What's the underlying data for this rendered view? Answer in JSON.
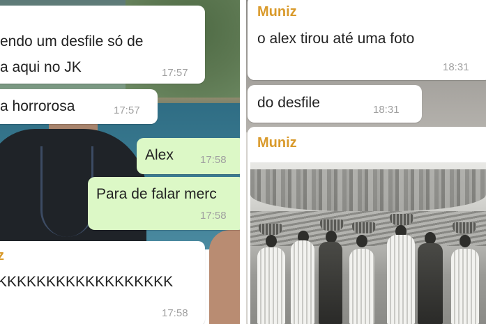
{
  "left": {
    "messages": [
      {
        "line1": "endo um desfile só de",
        "line2": "a aqui no JK",
        "time": "17:57"
      },
      {
        "text": "a horrorosa",
        "time": "17:57"
      },
      {
        "text": "Alex",
        "time": "17:58"
      },
      {
        "text": "Para de falar merc",
        "time": "17:58"
      },
      {
        "sender": "z",
        "text": "KKKKKKKKKKKKKKKKKK",
        "time": "17:58"
      }
    ]
  },
  "right": {
    "messages": [
      {
        "sender": "Muniz",
        "text": "o alex tirou até uma foto",
        "time": "18:31"
      },
      {
        "text": "do desfile",
        "time": "18:31"
      },
      {
        "sender": "Muniz"
      }
    ]
  },
  "colors": {
    "incoming": "#ffffff",
    "outgoing": "#dcf8c6",
    "sender_name": "#d99a2b",
    "timestamp": "#a0a0a0"
  }
}
